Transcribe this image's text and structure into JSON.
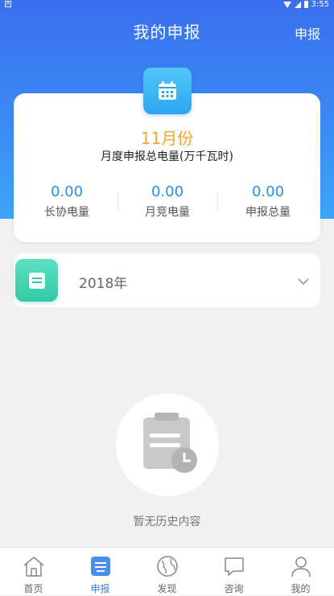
{
  "status_bar": {
    "left_icon": "A",
    "time": "3:55"
  },
  "header": {
    "title": "我的申报",
    "action_label": "申报"
  },
  "summary": {
    "month": "11月份",
    "subtitle": "月度申报总电量(万千瓦时)",
    "stats": [
      {
        "value": "0.00",
        "label": "长协电量"
      },
      {
        "value": "0.00",
        "label": "月竞电量"
      },
      {
        "value": "0.00",
        "label": "申报总量"
      }
    ]
  },
  "year_selector": {
    "value": "2018年"
  },
  "empty_state": {
    "text": "暂无历史内容"
  },
  "tabbar": {
    "items": [
      {
        "label": "首页",
        "icon": "home-icon"
      },
      {
        "label": "申报",
        "icon": "declare-icon",
        "active": true
      },
      {
        "label": "发现",
        "icon": "globe-icon"
      },
      {
        "label": "咨询",
        "icon": "chat-icon"
      },
      {
        "label": "我的",
        "icon": "user-icon"
      }
    ]
  },
  "colors": {
    "header_top": "#3a6ff0",
    "header_bottom": "#3ba6f7",
    "accent_orange": "#f6a53a",
    "accent_blue": "#2d8de6",
    "teal": "#2fcaa6"
  }
}
